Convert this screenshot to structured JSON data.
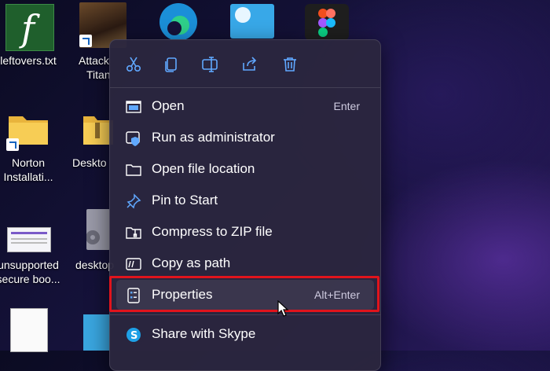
{
  "desktop": {
    "icons": [
      {
        "label": "leftovers.txt"
      },
      {
        "label": "Attack"
      },
      {
        "label": "Titan"
      },
      {
        "label": "Norton"
      },
      {
        "label": "Installati..."
      },
      {
        "label": "Deskto"
      },
      {
        "label": "unsupported"
      },
      {
        "label": "secure boo..."
      },
      {
        "label": "desktop"
      }
    ]
  },
  "context_menu": {
    "toolbar": [
      {
        "icon": "cut-icon"
      },
      {
        "icon": "copy-icon"
      },
      {
        "icon": "rename-icon"
      },
      {
        "icon": "share-icon"
      },
      {
        "icon": "delete-icon"
      }
    ],
    "items": [
      {
        "label": "Open",
        "shortcut": "Enter",
        "icon": "open-window-icon"
      },
      {
        "label": "Run as administrator",
        "shortcut": "",
        "icon": "shield-admin-icon"
      },
      {
        "label": "Open file location",
        "shortcut": "",
        "icon": "folder-icon"
      },
      {
        "label": "Pin to Start",
        "shortcut": "",
        "icon": "pin-icon"
      },
      {
        "label": "Compress to ZIP file",
        "shortcut": "",
        "icon": "zip-folder-icon"
      },
      {
        "label": "Copy as path",
        "shortcut": "",
        "icon": "copy-path-icon"
      },
      {
        "label": "Properties",
        "shortcut": "Alt+Enter",
        "icon": "properties-icon"
      },
      {
        "label": "Share with Skype",
        "shortcut": "",
        "icon": "skype-icon"
      }
    ]
  },
  "colors": {
    "menu_bg": "#2b273e",
    "accent_icon": "#60a8ff",
    "highlight_border": "#e0141c"
  }
}
